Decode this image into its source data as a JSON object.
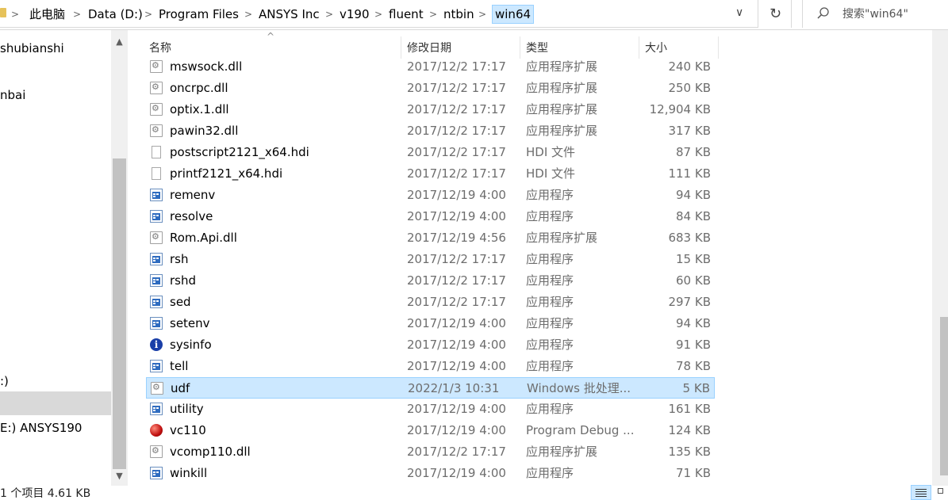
{
  "address": {
    "crumbs": [
      "此电脑",
      "Data (D:)",
      "Program Files",
      "ANSYS Inc",
      "v190",
      "fluent",
      "ntbin",
      "win64"
    ],
    "separator": ">",
    "dropdown_glyph": "∨",
    "refresh_glyph": "↻"
  },
  "search": {
    "placeholder": "搜索\"win64\""
  },
  "nav": {
    "items": [
      "shubianshi",
      "nbai",
      ":)",
      "",
      "E:) ANSYS190"
    ]
  },
  "columns": {
    "name": "名称",
    "date": "修改日期",
    "type": "类型",
    "size": "大小"
  },
  "files": [
    {
      "name": "mswsock.dll",
      "date": "2017/12/2 17:17",
      "type": "应用程序扩展",
      "size": "240 KB",
      "icon": "dll-gear-icon"
    },
    {
      "name": "oncrpc.dll",
      "date": "2017/12/2 17:17",
      "type": "应用程序扩展",
      "size": "250 KB",
      "icon": "dll-gear-icon"
    },
    {
      "name": "optix.1.dll",
      "date": "2017/12/2 17:17",
      "type": "应用程序扩展",
      "size": "12,904 KB",
      "icon": "dll-gear-icon"
    },
    {
      "name": "pawin32.dll",
      "date": "2017/12/2 17:17",
      "type": "应用程序扩展",
      "size": "317 KB",
      "icon": "dll-gear-icon"
    },
    {
      "name": "postscript2121_x64.hdi",
      "date": "2017/12/2 17:17",
      "type": "HDI 文件",
      "size": "87 KB",
      "icon": "blank-file-icon"
    },
    {
      "name": "printf2121_x64.hdi",
      "date": "2017/12/2 17:17",
      "type": "HDI 文件",
      "size": "111 KB",
      "icon": "blank-file-icon"
    },
    {
      "name": "remenv",
      "date": "2017/12/19 4:00",
      "type": "应用程序",
      "size": "94 KB",
      "icon": "exe-window-icon"
    },
    {
      "name": "resolve",
      "date": "2017/12/19 4:00",
      "type": "应用程序",
      "size": "84 KB",
      "icon": "exe-window-icon"
    },
    {
      "name": "Rom.Api.dll",
      "date": "2017/12/19 4:56",
      "type": "应用程序扩展",
      "size": "683 KB",
      "icon": "dll-gear-icon"
    },
    {
      "name": "rsh",
      "date": "2017/12/2 17:17",
      "type": "应用程序",
      "size": "15 KB",
      "icon": "exe-window-icon"
    },
    {
      "name": "rshd",
      "date": "2017/12/2 17:17",
      "type": "应用程序",
      "size": "60 KB",
      "icon": "exe-window-icon"
    },
    {
      "name": "sed",
      "date": "2017/12/2 17:17",
      "type": "应用程序",
      "size": "297 KB",
      "icon": "exe-window-icon"
    },
    {
      "name": "setenv",
      "date": "2017/12/19 4:00",
      "type": "应用程序",
      "size": "94 KB",
      "icon": "exe-window-icon"
    },
    {
      "name": "sysinfo",
      "date": "2017/12/19 4:00",
      "type": "应用程序",
      "size": "91 KB",
      "icon": "info-icon"
    },
    {
      "name": "tell",
      "date": "2017/12/19 4:00",
      "type": "应用程序",
      "size": "78 KB",
      "icon": "exe-window-icon"
    },
    {
      "name": "udf",
      "date": "2022/1/3 10:31",
      "type": "Windows 批处理...",
      "size": "5 KB",
      "icon": "batch-gear-icon",
      "selected": true
    },
    {
      "name": "utility",
      "date": "2017/12/19 4:00",
      "type": "应用程序",
      "size": "161 KB",
      "icon": "exe-window-icon"
    },
    {
      "name": "vc110",
      "date": "2017/12/19 4:00",
      "type": "Program Debug ...",
      "size": "124 KB",
      "icon": "debug-ball-icon"
    },
    {
      "name": "vcomp110.dll",
      "date": "2017/12/2 17:17",
      "type": "应用程序扩展",
      "size": "135 KB",
      "icon": "dll-gear-icon"
    },
    {
      "name": "winkill",
      "date": "2017/12/19 4:00",
      "type": "应用程序",
      "size": "71 KB",
      "icon": "exe-window-icon"
    }
  ],
  "status": {
    "text": "1 个项目  4.61 KB"
  },
  "colors": {
    "selection": "#cce8ff",
    "selection_border": "#99d1ff",
    "muted_text": "#6d6d6d"
  }
}
